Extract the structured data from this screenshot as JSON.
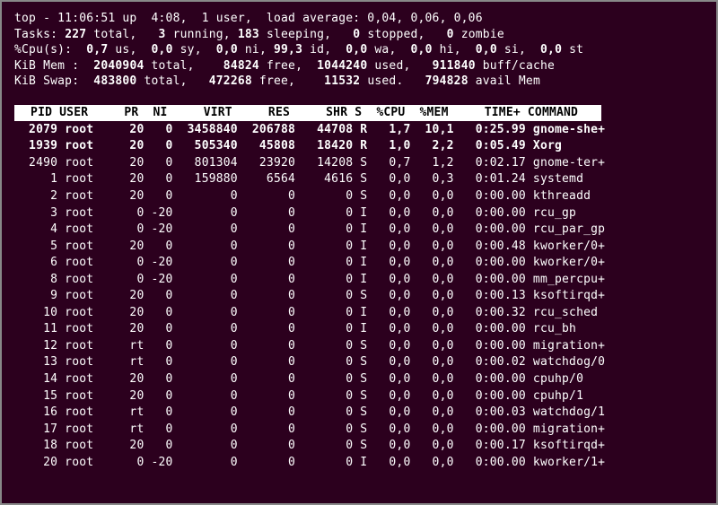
{
  "chart_data": {
    "type": "table",
    "title": "top",
    "columns": [
      "PID",
      "USER",
      "PR",
      "NI",
      "VIRT",
      "RES",
      "SHR",
      "S",
      "%CPU",
      "%MEM",
      "TIME+",
      "COMMAND"
    ],
    "rows": [
      [
        2079,
        "root",
        "20",
        0,
        3458840,
        206788,
        44708,
        "R",
        1.7,
        10.1,
        "0:25.99",
        "gnome-she+"
      ],
      [
        1939,
        "root",
        "20",
        0,
        505340,
        45808,
        18420,
        "R",
        1.0,
        2.2,
        "0:05.49",
        "Xorg"
      ],
      [
        2490,
        "root",
        "20",
        0,
        801304,
        23920,
        14208,
        "S",
        0.7,
        1.2,
        "0:02.17",
        "gnome-ter+"
      ],
      [
        1,
        "root",
        "20",
        0,
        159880,
        6564,
        4616,
        "S",
        0.0,
        0.3,
        "0:01.24",
        "systemd"
      ],
      [
        2,
        "root",
        "20",
        0,
        0,
        0,
        0,
        "S",
        0.0,
        0.0,
        "0:00.00",
        "kthreadd"
      ],
      [
        3,
        "root",
        "0",
        -20,
        0,
        0,
        0,
        "I",
        0.0,
        0.0,
        "0:00.00",
        "rcu_gp"
      ],
      [
        4,
        "root",
        "0",
        -20,
        0,
        0,
        0,
        "I",
        0.0,
        0.0,
        "0:00.00",
        "rcu_par_gp"
      ],
      [
        5,
        "root",
        "20",
        0,
        0,
        0,
        0,
        "I",
        0.0,
        0.0,
        "0:00.48",
        "kworker/0+"
      ],
      [
        6,
        "root",
        "0",
        -20,
        0,
        0,
        0,
        "I",
        0.0,
        0.0,
        "0:00.00",
        "kworker/0+"
      ],
      [
        8,
        "root",
        "0",
        -20,
        0,
        0,
        0,
        "I",
        0.0,
        0.0,
        "0:00.00",
        "mm_percpu+"
      ],
      [
        9,
        "root",
        "20",
        0,
        0,
        0,
        0,
        "S",
        0.0,
        0.0,
        "0:00.13",
        "ksoftirqd+"
      ],
      [
        10,
        "root",
        "20",
        0,
        0,
        0,
        0,
        "I",
        0.0,
        0.0,
        "0:00.32",
        "rcu_sched"
      ],
      [
        11,
        "root",
        "20",
        0,
        0,
        0,
        0,
        "I",
        0.0,
        0.0,
        "0:00.00",
        "rcu_bh"
      ],
      [
        12,
        "root",
        "rt",
        0,
        0,
        0,
        0,
        "S",
        0.0,
        0.0,
        "0:00.00",
        "migration+"
      ],
      [
        13,
        "root",
        "rt",
        0,
        0,
        0,
        0,
        "S",
        0.0,
        0.0,
        "0:00.02",
        "watchdog/0"
      ],
      [
        14,
        "root",
        "20",
        0,
        0,
        0,
        0,
        "S",
        0.0,
        0.0,
        "0:00.00",
        "cpuhp/0"
      ],
      [
        15,
        "root",
        "20",
        0,
        0,
        0,
        0,
        "S",
        0.0,
        0.0,
        "0:00.00",
        "cpuhp/1"
      ],
      [
        16,
        "root",
        "rt",
        0,
        0,
        0,
        0,
        "S",
        0.0,
        0.0,
        "0:00.03",
        "watchdog/1"
      ],
      [
        17,
        "root",
        "rt",
        0,
        0,
        0,
        0,
        "S",
        0.0,
        0.0,
        "0:00.00",
        "migration+"
      ],
      [
        18,
        "root",
        "20",
        0,
        0,
        0,
        0,
        "S",
        0.0,
        0.0,
        "0:00.17",
        "ksoftirqd+"
      ],
      [
        20,
        "root",
        "0",
        -20,
        0,
        0,
        0,
        "I",
        0.0,
        0.0,
        "0:00.00",
        "kworker/1+"
      ]
    ]
  },
  "summary": {
    "line1_a": "top - 11:06:51 up  4:08,  1 user,  load average: 0,04, 0,06, 0,06",
    "line2_a": "Tasks: ",
    "line2_b": "227 ",
    "line2_c": "total,   ",
    "line2_d": "3 ",
    "line2_e": "running, ",
    "line2_f": "183 ",
    "line2_g": "sleeping,   ",
    "line2_h": "0 ",
    "line2_i": "stopped,   ",
    "line2_j": "0 ",
    "line2_k": "zombie",
    "line3": "%Cpu(s):  0,7 us,  0,0 sy,  0,0 ni, 99,3 id,  0,0 wa,  0,0 hi,  0,0 si,  0,0 st",
    "line4_a": "KiB Mem : ",
    "line4_b": " 2040904 ",
    "line4_c": "total,   ",
    "line4_d": " 84824 ",
    "line4_e": "free,  ",
    "line4_f": "1044240 ",
    "line4_g": "used,   ",
    "line4_h": "911840 ",
    "line4_i": "buff/cache",
    "line5_a": "KiB Swap:  ",
    "line5_b": "483800 ",
    "line5_c": "total,   ",
    "line5_d": "472268 ",
    "line5_e": "free,    ",
    "line5_f": "11532 ",
    "line5_g": "used.   ",
    "line5_h": "794828 ",
    "line5_i": "avail Mem"
  },
  "header_widths": {
    "pid": 5,
    "user": 8,
    "pr": 3,
    "ni": 3,
    "virt": 8,
    "res": 7,
    "shr": 7,
    "s": 1,
    "cpu": 5,
    "mem": 5,
    "time": 9,
    "cmd": 10
  },
  "header_labels": {
    "pid": "PID",
    "user": "USER",
    "pr": "PR",
    "ni": "NI",
    "virt": "VIRT",
    "res": "RES",
    "shr": "SHR",
    "s": "S",
    "cpu": "%CPU",
    "mem": "%MEM",
    "time": "TIME+",
    "cmd": "COMMAND"
  }
}
